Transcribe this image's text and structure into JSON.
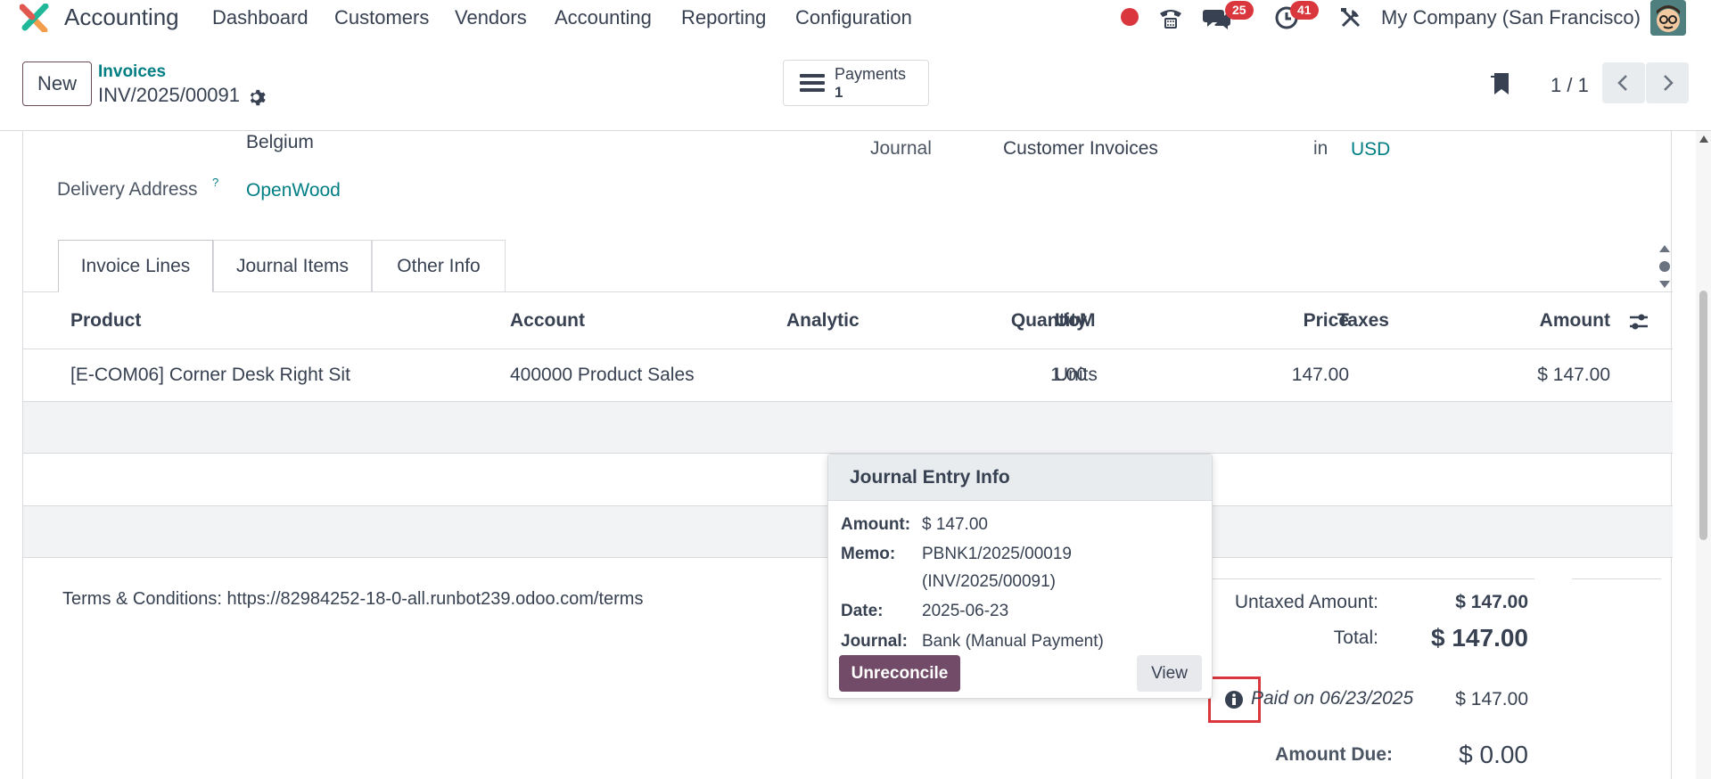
{
  "app": {
    "name": "Accounting"
  },
  "nav": {
    "menu": [
      "Dashboard",
      "Customers",
      "Vendors",
      "Accounting",
      "Reporting",
      "Configuration"
    ],
    "messages_badge": "25",
    "activities_badge": "41",
    "company": "My Company (San Francisco)"
  },
  "control": {
    "new_label": "New",
    "breadcrumb_parent": "Invoices",
    "record_name": "INV/2025/00091",
    "stat_label": "Payments",
    "stat_value": "1",
    "pager": "1 / 1"
  },
  "form": {
    "address_country": "Belgium",
    "delivery_label": "Delivery Address",
    "delivery_help": "?",
    "delivery_value": "OpenWood",
    "journal_label": "Journal",
    "journal_value": "Customer Invoices",
    "currency_in": "in",
    "currency": "USD"
  },
  "tabs": [
    "Invoice Lines",
    "Journal Items",
    "Other Info"
  ],
  "table": {
    "headers": [
      "Product",
      "Account",
      "Analytic",
      "Quantity",
      "UoM",
      "Price",
      "Taxes",
      "Amount"
    ],
    "rows": [
      {
        "product": "[E-COM06] Corner Desk Right Sit",
        "account": "400000 Product Sales",
        "analytic": "",
        "quantity": "1.00",
        "uom": "Units",
        "price": "147.00",
        "taxes": "",
        "amount": "$ 147.00"
      }
    ]
  },
  "terms": "Terms & Conditions: https://82984252-18-0-all.runbot239.odoo.com/terms",
  "totals": {
    "untaxed_label": "Untaxed Amount:",
    "untaxed_value": "$ 147.00",
    "total_label": "Total:",
    "total_value": "$ 147.00",
    "paid_label": "Paid on 06/23/2025",
    "paid_value": "$ 147.00",
    "due_label": "Amount Due:",
    "due_value": "$ 0.00"
  },
  "popover": {
    "title": "Journal Entry Info",
    "amount_label": "Amount:",
    "amount_value": "$ 147.00",
    "memo_label": "Memo:",
    "memo_line1": "PBNK1/2025/00019",
    "memo_line2": "(INV/2025/00091)",
    "date_label": "Date:",
    "date_value": "2025-06-23",
    "journal_label": "Journal:",
    "journal_value": "Bank (Manual Payment)",
    "unreconcile_label": "Unreconcile",
    "view_label": "View"
  },
  "colors": {
    "brand": "#714b67",
    "link": "#017e84",
    "badge": "#d9363e",
    "highlight": "#d9363e"
  }
}
